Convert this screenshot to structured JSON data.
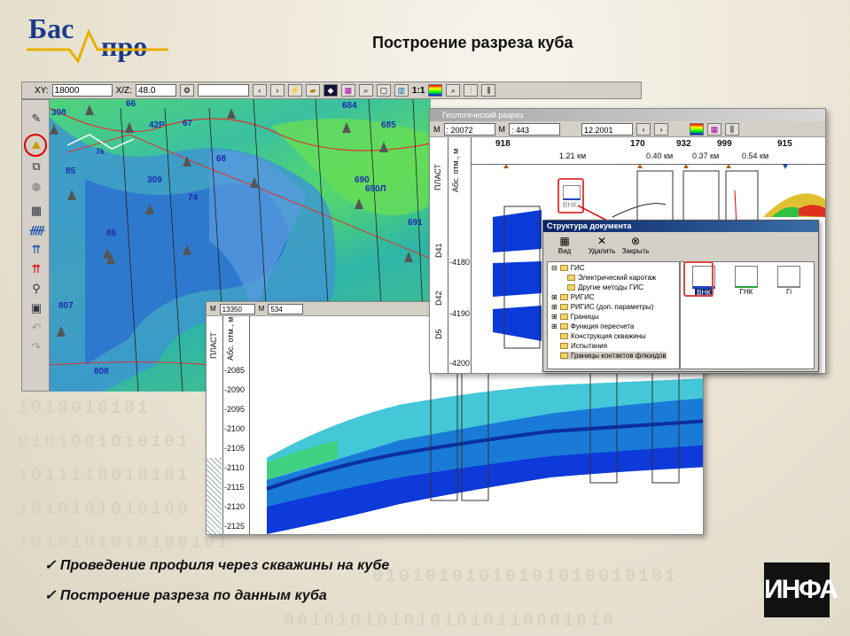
{
  "logo": {
    "part1": "Бас",
    "part2": "про"
  },
  "slide": {
    "title": "Построение разреза куба"
  },
  "toolbar": {
    "xy_label": "XY:",
    "xy_value": "18000",
    "xz_label": "X/Z:",
    "xz_value": "48.0",
    "scale_label": "1:1"
  },
  "map": {
    "wells": [
      "308",
      "66",
      "42Р",
      "67",
      "684",
      "685",
      "85",
      "309",
      "68",
      "690",
      "690Л",
      "86",
      "74",
      "691",
      "807",
      "808",
      "7k"
    ]
  },
  "geo_window": {
    "title": "Геологический разрез",
    "field1": ": 20072",
    "field2": ": 443",
    "field3": "12.2001",
    "col_plast": "ПЛАСТ",
    "col_abs": "Абс. отм., м",
    "wells": [
      "918",
      "170",
      "932",
      "999",
      "915"
    ],
    "distances": [
      "1.21 км",
      "0.40 км",
      "0.37 км",
      "0.54 км"
    ],
    "layers": [
      "D41",
      "D42",
      "D5"
    ],
    "depths": [
      "-4180",
      "-4190",
      "-4200"
    ],
    "vnk_label": "ВНК"
  },
  "struct_window": {
    "title": "Структура документа",
    "buttons": [
      "Вид",
      "Удалить",
      "Закрыть"
    ],
    "tree": [
      "ГИС",
      "Электрический каротаж",
      "Другие методы ГИС",
      "РИГИС",
      "РИГИС (доп. параметры)",
      "Границы",
      "Функция пересчета",
      "Конструкция скважины",
      "Испытания",
      "Границы контактов флюидов"
    ],
    "icons": [
      "ВНК",
      "ГНК",
      "Гi"
    ]
  },
  "cube_window": {
    "field1": "13350",
    "field2": "534",
    "col_plast": "ПЛАСТ",
    "col_abs": "Абс. отм., м",
    "depths": [
      "-2085",
      "-2090",
      "-2095",
      "-2100",
      "-2105",
      "-2110",
      "-2115",
      "-2120",
      "-2125"
    ]
  },
  "bullets": [
    "Проведение профиля через скважины на кубе",
    "Построение разреза по данным куба"
  ],
  "brand": "ИНФА",
  "binary_bg": [
    "1010010101",
    "0101001010101",
    "1011110010101",
    "1010101010100",
    "1010101010100101",
    "01010101010101010010101",
    "0010101010101010110001010"
  ]
}
